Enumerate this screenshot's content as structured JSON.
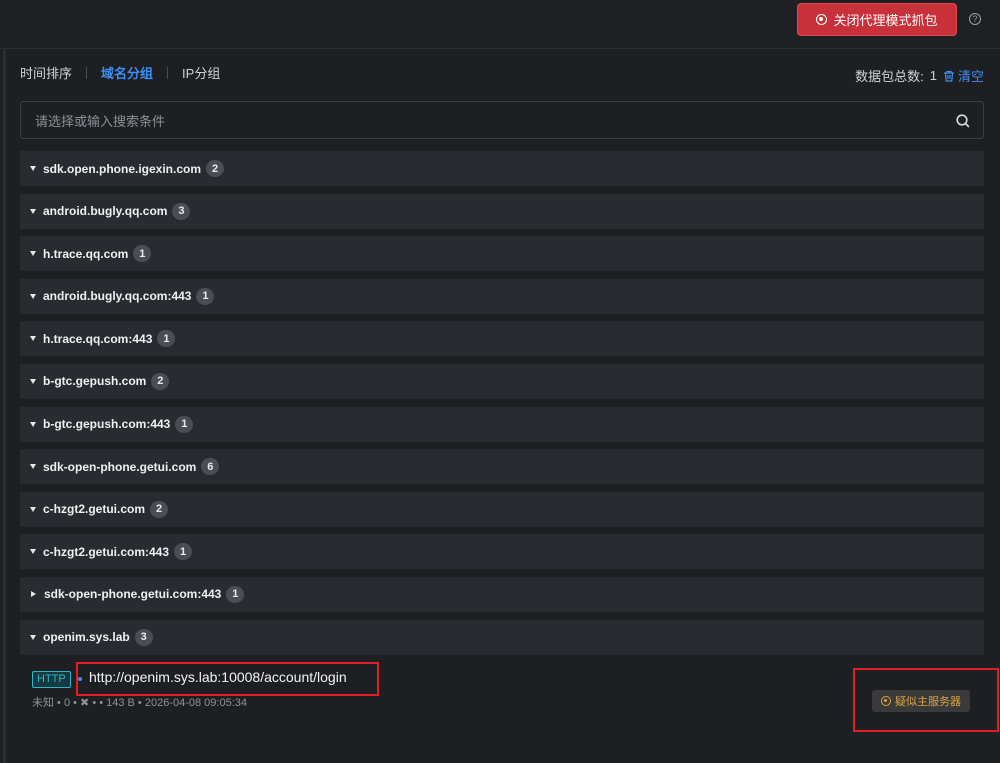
{
  "header": {
    "stop_capture_label": "关闭代理模式抓包",
    "help_glyph": "?"
  },
  "tabs": [
    {
      "label": "时间排序",
      "active": false
    },
    {
      "label": "域名分组",
      "active": true
    },
    {
      "label": "IP分组",
      "active": false
    }
  ],
  "summary": {
    "total_label": "数据包总数:",
    "total_value": "1",
    "clear_label": "清空"
  },
  "search": {
    "placeholder": "请选择或输入搜索条件"
  },
  "groups": [
    {
      "domain": "sdk.open.phone.igexin.com",
      "count": "2",
      "expanded": true
    },
    {
      "domain": "android.bugly.qq.com",
      "count": "3",
      "expanded": true
    },
    {
      "domain": "h.trace.qq.com",
      "count": "1",
      "expanded": true
    },
    {
      "domain": "android.bugly.qq.com:443",
      "count": "1",
      "expanded": true
    },
    {
      "domain": "h.trace.qq.com:443",
      "count": "1",
      "expanded": true
    },
    {
      "domain": "b-gtc.gepush.com",
      "count": "2",
      "expanded": true
    },
    {
      "domain": "b-gtc.gepush.com:443",
      "count": "1",
      "expanded": true
    },
    {
      "domain": "sdk-open-phone.getui.com",
      "count": "6",
      "expanded": true
    },
    {
      "domain": "c-hzgt2.getui.com",
      "count": "2",
      "expanded": true
    },
    {
      "domain": "c-hzgt2.getui.com:443",
      "count": "1",
      "expanded": true
    },
    {
      "domain": "sdk-open-phone.getui.com:443",
      "count": "1",
      "expanded": false
    },
    {
      "domain": "openim.sys.lab",
      "count": "3",
      "expanded": true
    }
  ],
  "request": {
    "protocol": "HTTP",
    "url": "http://openim.sys.lab:10008/account/login",
    "meta": "未知 • 0 • ✖ • • 143 B • 2026-04-08 09:05:34",
    "server_tag": "疑似主服务器"
  },
  "colors": {
    "accent": "#3d8ff2",
    "danger": "#c8313a",
    "highlight_box": "#e01e24",
    "server_tag_text": "#d9a441"
  }
}
